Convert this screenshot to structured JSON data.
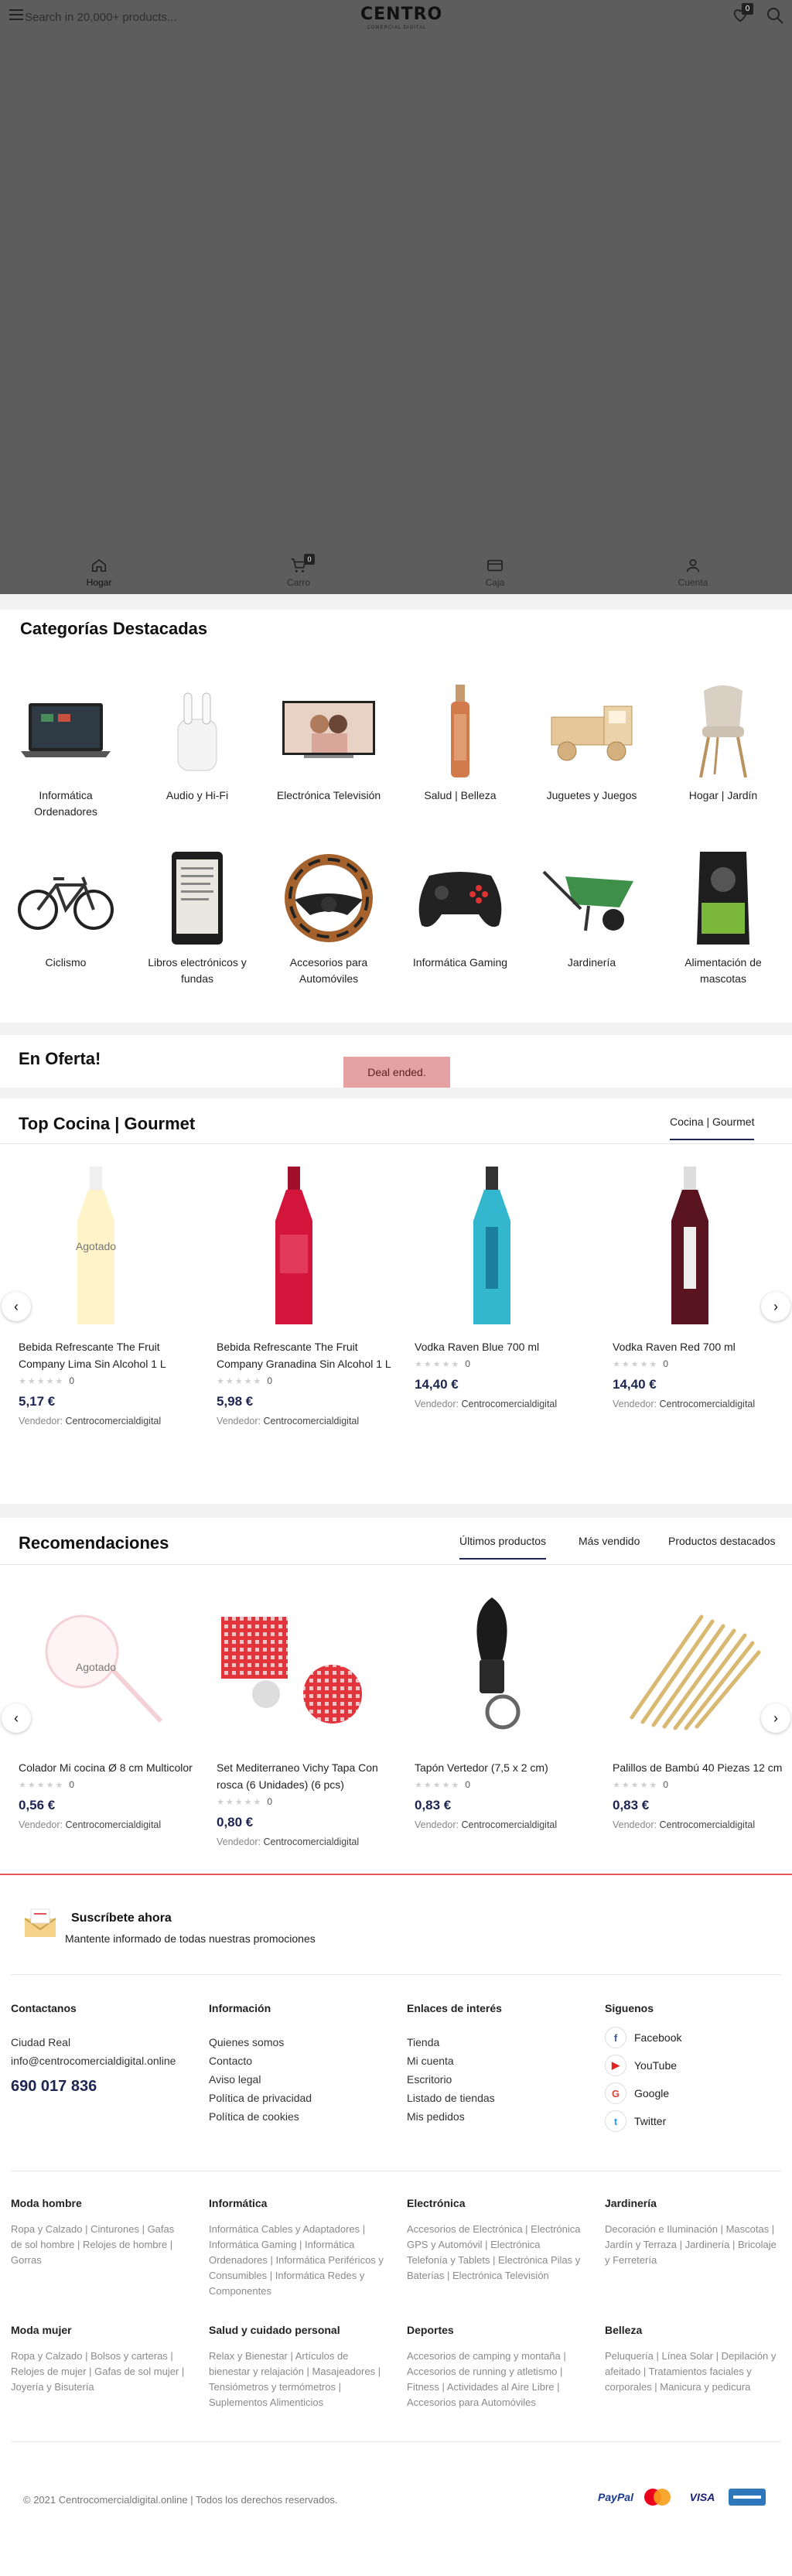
{
  "header": {
    "search_placeholder": "Search in 20,000+ products...",
    "logo_text": "CENTRO",
    "logo_tagline": "COMERCIAL DIGITAL",
    "wishlist_count": "0"
  },
  "bottom_nav": {
    "home": "Hogar",
    "cart": "Carro",
    "cart_count": "0",
    "pay": "Caja",
    "account": "Cuenta"
  },
  "categories": {
    "title": "Categorías Destacadas",
    "items": [
      {
        "label": "Informática Ordenadores"
      },
      {
        "label": "Audio y Hi-Fi"
      },
      {
        "label": "Electrónica Televisión"
      },
      {
        "label": "Salud | Belleza"
      },
      {
        "label": "Juguetes y Juegos"
      },
      {
        "label": "Hogar | Jardín"
      },
      {
        "label": "Ciclismo"
      },
      {
        "label": "Libros electrónicos y fundas"
      },
      {
        "label": "Accesorios para Automóviles"
      },
      {
        "label": "Informática Gaming"
      },
      {
        "label": "Jardinería"
      },
      {
        "label": "Alimentación de mascotas"
      }
    ]
  },
  "offer": {
    "title": "En Oferta!",
    "deal_status": "Deal ended."
  },
  "top_cocina": {
    "title": "Top Cocina | Gourmet",
    "tab": "Cocina | Gourmet",
    "products": [
      {
        "title": "Bebida Refrescante The Fruit Company Lima Sin Alcohol 1 L",
        "rating_count": "0",
        "price": "5,17 €",
        "seller_label": "Vendedor:",
        "seller": "Centrocomercialdigital",
        "badge": "Agotado"
      },
      {
        "title": "Bebida Refrescante The Fruit Company Granadina Sin Alcohol 1 L",
        "rating_count": "0",
        "price": "5,98 €",
        "seller_label": "Vendedor:",
        "seller": "Centrocomercialdigital",
        "badge": ""
      },
      {
        "title": "Vodka Raven Blue 700 ml",
        "rating_count": "0",
        "price": "14,40 €",
        "seller_label": "Vendedor:",
        "seller": "Centrocomercialdigital",
        "badge": ""
      },
      {
        "title": "Vodka Raven Red 700 ml",
        "rating_count": "0",
        "price": "14,40 €",
        "seller_label": "Vendedor:",
        "seller": "Centrocomercialdigital",
        "badge": ""
      }
    ]
  },
  "recommendations": {
    "title": "Recomendaciones",
    "tabs": [
      "Últimos productos",
      "Más vendido",
      "Productos destacados"
    ],
    "products": [
      {
        "title": "Colador Mi cocina Ø 8 cm Multicolor",
        "rating_count": "0",
        "price": "0,56 €",
        "seller_label": "Vendedor:",
        "seller": "Centrocomercialdigital",
        "badge": "Agotado"
      },
      {
        "title": "Set Mediterraneo Vichy Tapa Con rosca (6 Unidades) (6 pcs)",
        "rating_count": "0",
        "price": "0,80 €",
        "seller_label": "Vendedor:",
        "seller": "Centrocomercialdigital",
        "badge": ""
      },
      {
        "title": "Tapón Vertedor (7,5 x 2 cm)",
        "rating_count": "0",
        "price": "0,83 €",
        "seller_label": "Vendedor:",
        "seller": "Centrocomercialdigital",
        "badge": ""
      },
      {
        "title": "Palillos de Bambú 40 Piezas 12 cm",
        "rating_count": "0",
        "price": "0,83 €",
        "seller_label": "Vendedor:",
        "seller": "Centrocomercialdigital",
        "badge": ""
      }
    ]
  },
  "newsletter": {
    "title": "Suscríbete ahora",
    "text": "Mantente informado de todas nuestras promociones"
  },
  "footer": {
    "contact": {
      "heading": "Contactanos",
      "city": "Ciudad Real",
      "email": "info@centrocomercialdigital.online",
      "phone": "690 017 836"
    },
    "info": {
      "heading": "Información",
      "links": [
        "Quienes somos",
        "Contacto",
        "Aviso legal",
        "Política de privacidad",
        "Política de cookies"
      ]
    },
    "links_of_interest": {
      "heading": "Enlaces de interés",
      "links": [
        "Tienda",
        "Mi cuenta",
        "Escritorio",
        "Listado de tiendas",
        "Mis pedidos"
      ]
    },
    "social": {
      "heading": "Siguenos",
      "items": [
        "Facebook",
        "YouTube",
        "Google",
        "Twitter"
      ]
    },
    "sitemap": [
      {
        "heading": "Moda hombre",
        "text": "Ropa y Calzado | Cinturones | Gafas de sol hombre | Relojes de hombre | Gorras"
      },
      {
        "heading": "Informática",
        "text": "Informática Cables y Adaptadores | Informática Gaming | Informática Ordenadores | Informática Periféricos y Consumibles | Informática Redes y Componentes"
      },
      {
        "heading": "Electrónica",
        "text": "Accesorios de Electrónica | Electrónica GPS y Automóvil | Electrónica Telefonía y Tablets | Electrónica Pilas y Baterías | Electrónica Televisión"
      },
      {
        "heading": "Jardinería",
        "text": "Decoración e Iluminación | Mascotas | Jardín y Terraza | Jardinería | Bricolaje y Ferretería"
      },
      {
        "heading": "Moda mujer",
        "text": "Ropa y Calzado | Bolsos y carteras | Relojes de mujer | Gafas de sol mujer | Joyería y Bisutería"
      },
      {
        "heading": "Salud y cuidado personal",
        "text": "Relax y Bienestar | Artículos de bienestar y relajación | Masajeadores | Tensiómetros y termómetros | Suplementos Alimenticios"
      },
      {
        "heading": "Deportes",
        "text": "Accesorios de camping y montaña | Accesorios de running y atletismo | Fitness | Actividades al Aire Libre | Accesorios para Automóviles"
      },
      {
        "heading": "Belleza",
        "text": "Peluquería | Línea Solar | Depilación y afeitado | Tratamientos faciales y corporales | Manicura y pedicura"
      }
    ],
    "copyright": "© 2021 Centrocomercialdigital.online | Todos los derechos reservados.",
    "payments": [
      "PayPal",
      "Mastercard",
      "VISA",
      "American Express"
    ]
  },
  "colors": {
    "overlay": "#5d5d5d",
    "price_navy": "#1d2550",
    "deal_bg": "#e6a2a2",
    "accent_red": "#e05656"
  }
}
